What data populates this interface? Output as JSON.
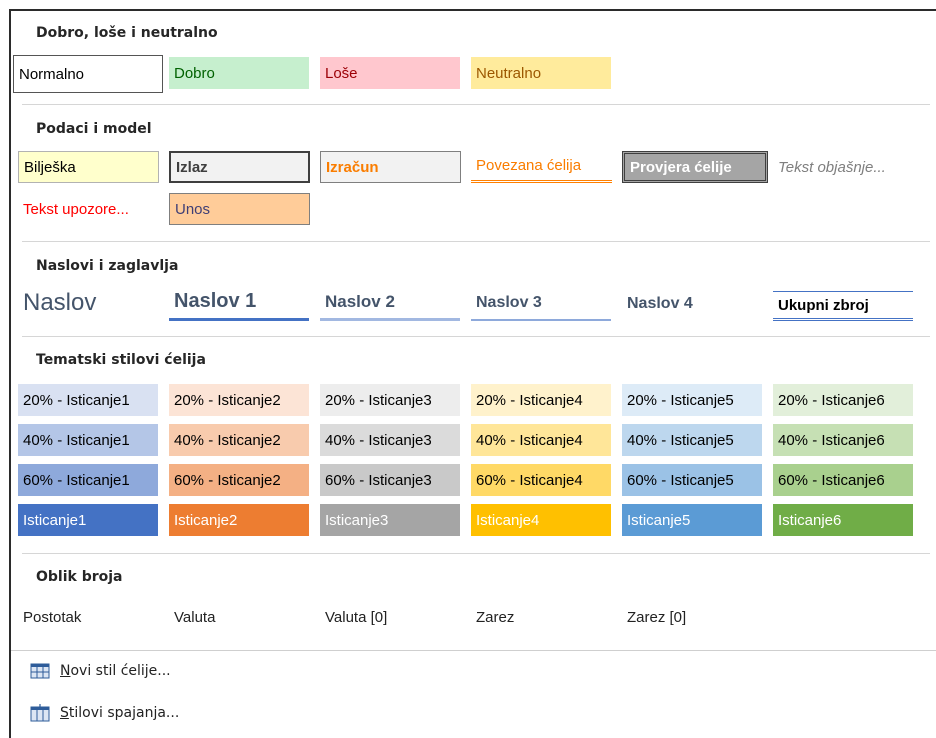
{
  "sections": {
    "good_bad": {
      "title": "Dobro, loše i neutralno",
      "styles": [
        "Normalno",
        "Dobro",
        "Loše",
        "Neutralno"
      ]
    },
    "data_model": {
      "title": "Podaci i model",
      "styles": [
        "Bilješka",
        "Izlaz",
        "Izračun",
        "Povezana ćelija",
        "Provjera ćelije",
        "Tekst objašnje...",
        "Tekst upozore...",
        "Unos"
      ]
    },
    "titles": {
      "title": "Naslovi i zaglavlja",
      "styles": [
        "Naslov",
        "Naslov 1",
        "Naslov 2",
        "Naslov 3",
        "Naslov 4",
        "Ukupni zbroj"
      ]
    },
    "themed": {
      "title": "Tematski stilovi ćelija",
      "row20": [
        "20% - Isticanje1",
        "20% - Isticanje2",
        "20% - Isticanje3",
        "20% - Isticanje4",
        "20% - Isticanje5",
        "20% - Isticanje6"
      ],
      "row40": [
        "40% - Isticanje1",
        "40% - Isticanje2",
        "40% - Isticanje3",
        "40% - Isticanje4",
        "40% - Isticanje5",
        "40% - Isticanje6"
      ],
      "row60": [
        "60% - Isticanje1",
        "60% - Isticanje2",
        "60% - Isticanje3",
        "60% - Isticanje4",
        "60% - Isticanje5",
        "60% - Isticanje6"
      ],
      "row100": [
        "Isticanje1",
        "Isticanje2",
        "Isticanje3",
        "Isticanje4",
        "Isticanje5",
        "Isticanje6"
      ]
    },
    "number_format": {
      "title": "Oblik broja",
      "styles": [
        "Postotak",
        "Valuta",
        "Valuta [0]",
        "Zarez",
        "Zarez [0]"
      ]
    }
  },
  "menu": {
    "new_style_key": "N",
    "new_style_rest": "ovi stil ćelije...",
    "merge_styles_key": "S",
    "merge_styles_rest": "tilovi spajanja..."
  },
  "colors": {
    "accent1": "#4472C4",
    "accent2": "#ED7D31",
    "accent3": "#A5A5A5",
    "accent4": "#FFC000",
    "accent5": "#5B9BD5",
    "accent6": "#70AD47"
  }
}
